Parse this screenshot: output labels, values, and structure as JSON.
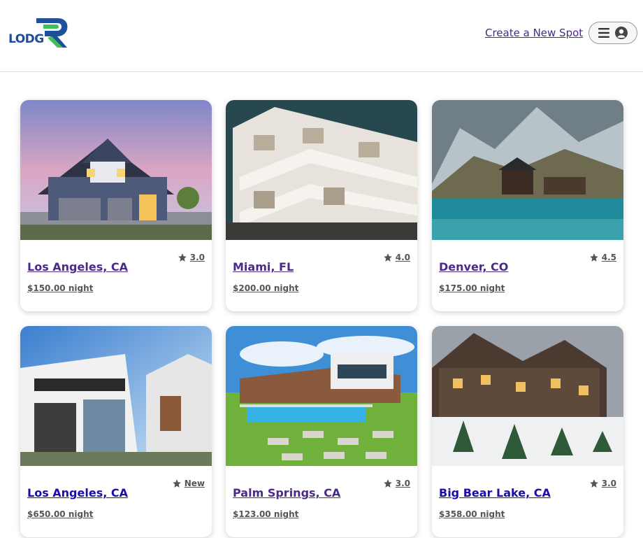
{
  "header": {
    "logo_text": "LODG",
    "create_link": "Create a New Spot"
  },
  "colors": {
    "logo_blue": "#1d4f9c",
    "logo_green": "#3fbf5a",
    "visited_link": "#4b2a8a",
    "unvisited_link": "#1a0dab"
  },
  "spots": [
    {
      "city": "Los Angeles, CA",
      "rating": "3.0",
      "price": "$150.00 night",
      "visited": true,
      "image": "suburban-house-dusk"
    },
    {
      "city": "Miami, FL",
      "rating": "4.0",
      "price": "$200.00 night",
      "visited": true,
      "image": "white-balcony-building"
    },
    {
      "city": "Denver, CO",
      "rating": "4.5",
      "price": "$175.00 night",
      "visited": true,
      "image": "mountain-lake-cabin"
    },
    {
      "city": "Los Angeles, CA",
      "rating": "New",
      "price": "$650.00 night",
      "visited": false,
      "image": "modern-glass-house"
    },
    {
      "city": "Palm Springs, CA",
      "rating": "3.0",
      "price": "$123.00 night",
      "visited": true,
      "image": "pool-villa"
    },
    {
      "city": "Big Bear Lake, CA",
      "rating": "3.0",
      "price": "$358.00 night",
      "visited": false,
      "image": "winter-chalet"
    }
  ]
}
